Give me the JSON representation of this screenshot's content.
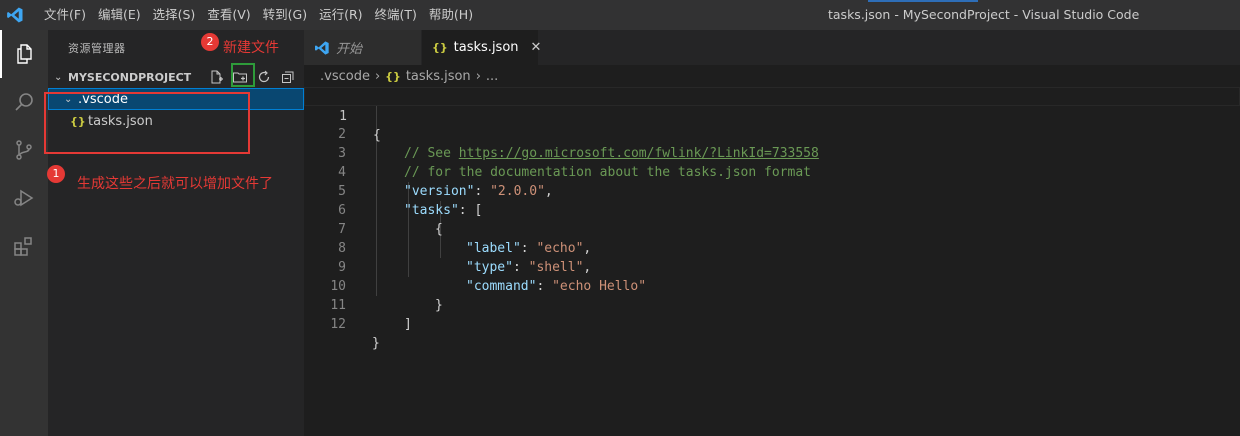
{
  "titlebar": {
    "menu": [
      "文件(F)",
      "编辑(E)",
      "选择(S)",
      "查看(V)",
      "转到(G)",
      "运行(R)",
      "终端(T)",
      "帮助(H)"
    ],
    "window_title": "tasks.json - MySecondProject - Visual Studio Code"
  },
  "activitybar": {
    "items": [
      "explorer-icon",
      "search-icon",
      "source-control-icon",
      "run-debug-icon",
      "extensions-icon"
    ]
  },
  "sidebar": {
    "title": "资源管理器",
    "section_title": "MYSECONDPROJECT",
    "actions": [
      "new-file-icon",
      "new-folder-icon",
      "refresh-icon",
      "collapse-all-icon"
    ],
    "tree": [
      {
        "label": ".vscode",
        "type": "folder",
        "expanded": true
      },
      {
        "label": "tasks.json",
        "type": "json-file"
      }
    ]
  },
  "annotations": {
    "badge1": "1",
    "text1": "生成这些之后就可以增加文件了",
    "badge2": "2",
    "text2": "新建文件"
  },
  "tabs": [
    {
      "label": "开始",
      "active": false
    },
    {
      "label": "tasks.json",
      "active": true,
      "close": "✕"
    }
  ],
  "breadcrumb": {
    "folder": ".vscode",
    "file": "tasks.json",
    "more": "..."
  },
  "editor": {
    "line_numbers": [
      "1",
      "2",
      "3",
      "4",
      "5",
      "6",
      "7",
      "8",
      "9",
      "10",
      "11",
      "12"
    ],
    "lines": {
      "l1": "{",
      "l2_comment": "// See ",
      "l2_link": "https://go.microsoft.com/fwlink/?LinkId=733558",
      "l3_comment": "// for the documentation about the tasks.json format",
      "l4_key": "\"version\"",
      "l4_val": "\"2.0.0\"",
      "l5_key": "\"tasks\"",
      "l5_open": "[",
      "l6": "{",
      "l7_key": "\"label\"",
      "l7_val": "\"echo\"",
      "l8_key": "\"type\"",
      "l8_val": "\"shell\"",
      "l9_key": "\"command\"",
      "l9_val": "\"echo Hello\"",
      "l10": "}",
      "l11": "]",
      "l12": "}"
    }
  },
  "colors": {
    "accent": "#007acc",
    "annotation_red": "#e53935",
    "annotation_green": "#2e9b3a"
  }
}
